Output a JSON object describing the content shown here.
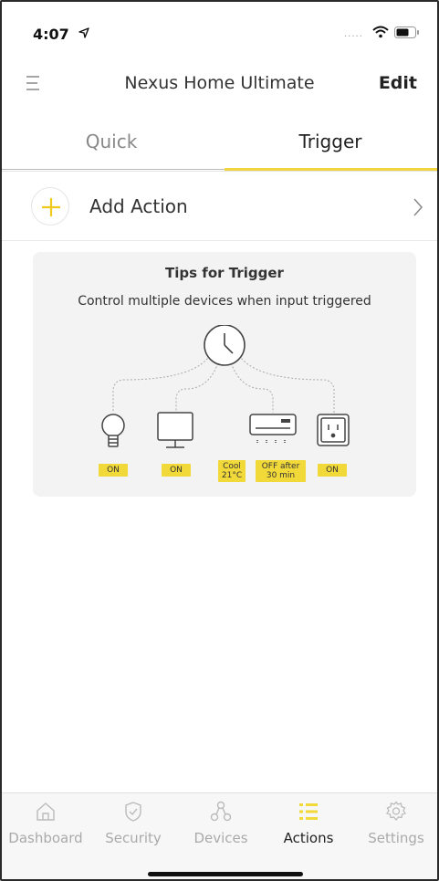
{
  "status": {
    "time": "4:07",
    "dots": "....."
  },
  "nav": {
    "title": "Nexus Home Ultimate",
    "edit": "Edit"
  },
  "tabs": [
    {
      "label": "Quick"
    },
    {
      "label": "Trigger"
    }
  ],
  "add_action": {
    "label": "Add Action"
  },
  "tips": {
    "title": "Tips for Trigger",
    "subtitle": "Control multiple devices when input triggered",
    "devices": [
      {
        "icon": "light-bulb-icon",
        "status": "ON"
      },
      {
        "icon": "monitor-icon",
        "status": "ON"
      },
      {
        "icon": "air-conditioner-icon",
        "status_lines": [
          "Cool",
          "21°C"
        ],
        "status_extra_lines": [
          "OFF after",
          "30 min"
        ]
      },
      {
        "icon": "power-outlet-icon",
        "status": "ON"
      }
    ],
    "trigger_icon": "clock-icon"
  },
  "tabbar": {
    "items": [
      {
        "label": "Dashboard",
        "icon": "home-icon"
      },
      {
        "label": "Security",
        "icon": "shield-icon"
      },
      {
        "label": "Devices",
        "icon": "devices-icon"
      },
      {
        "label": "Actions",
        "icon": "actions-list-icon"
      },
      {
        "label": "Settings",
        "icon": "gear-icon"
      }
    ],
    "active": "Actions"
  },
  "colors": {
    "accent": "#f2d93a",
    "text": "#333333",
    "muted": "#aaaaaa"
  }
}
